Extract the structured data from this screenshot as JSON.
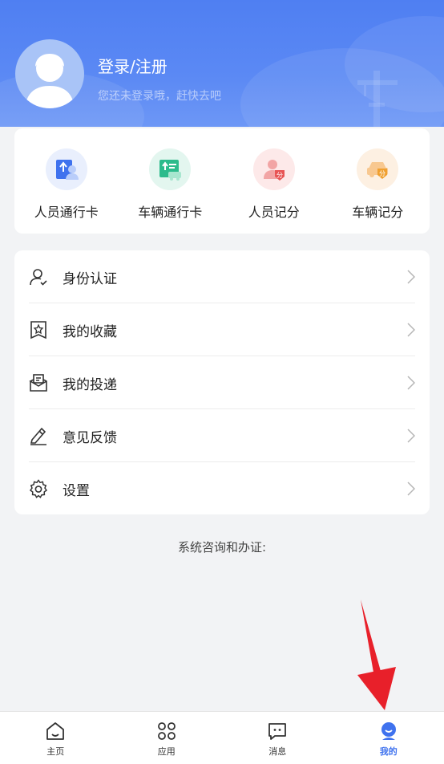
{
  "profile": {
    "title": "登录/注册",
    "subtitle": "您还未登录哦，赶快去吧"
  },
  "quick_actions": [
    {
      "label": "人员通行卡",
      "icon": "person-pass-icon",
      "bg": "#e9effd"
    },
    {
      "label": "车辆通行卡",
      "icon": "vehicle-pass-icon",
      "bg": "#e3f6ef"
    },
    {
      "label": "人员记分",
      "icon": "person-score-icon",
      "bg": "#fde9e9"
    },
    {
      "label": "车辆记分",
      "icon": "vehicle-score-icon",
      "bg": "#fdf0e2"
    }
  ],
  "menu": [
    {
      "label": "身份认证",
      "icon": "user-verify-icon"
    },
    {
      "label": "我的收藏",
      "icon": "bookmark-star-icon"
    },
    {
      "label": "我的投递",
      "icon": "mailbox-icon"
    },
    {
      "label": "意见反馈",
      "icon": "pencil-icon"
    },
    {
      "label": "设置",
      "icon": "gear-icon"
    }
  ],
  "consult_text": "系统咨询和办证:",
  "tabs": [
    {
      "label": "主页",
      "icon": "home-icon"
    },
    {
      "label": "应用",
      "icon": "apps-icon"
    },
    {
      "label": "消息",
      "icon": "message-icon"
    },
    {
      "label": "我的",
      "icon": "profile-icon"
    }
  ],
  "colors": {
    "header": "#5585f3",
    "accent": "#3f72ee",
    "annotation_arrow": "#e8202a"
  }
}
